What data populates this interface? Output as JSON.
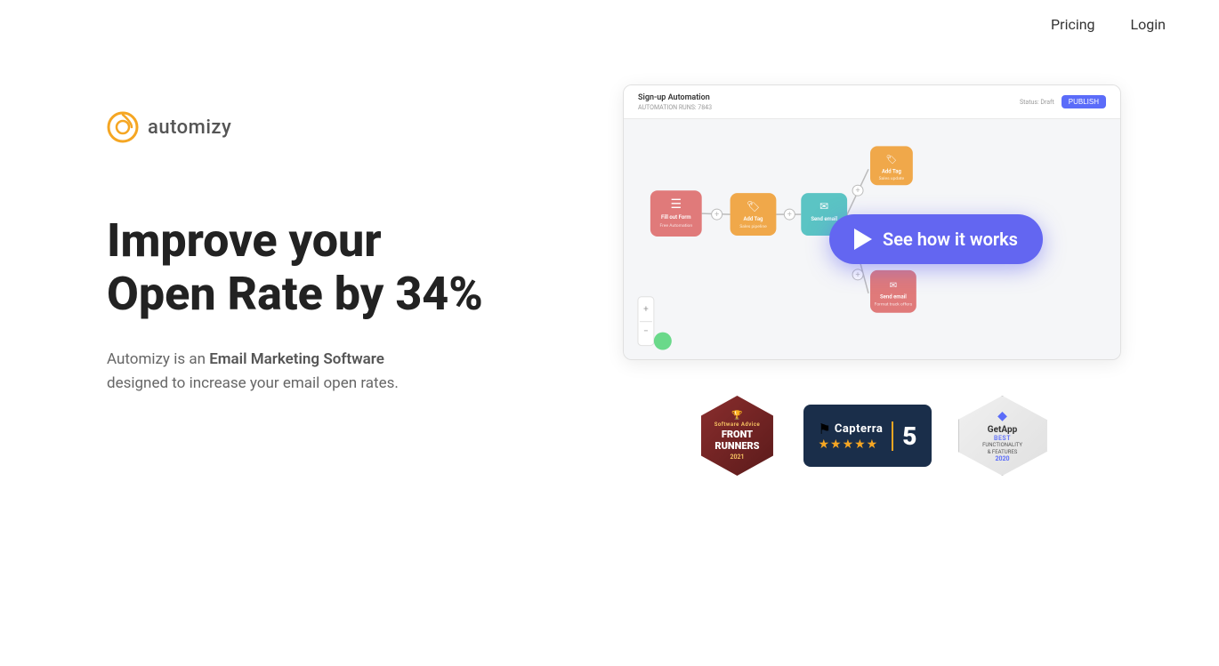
{
  "header": {
    "pricing_label": "Pricing",
    "login_label": "Login"
  },
  "logo": {
    "text": "automizy"
  },
  "hero": {
    "headline_line1": "Improve your",
    "headline_line2": "Open Rate by 34%",
    "subtext_prefix": "Automizy is an ",
    "subtext_bold": "Email Marketing Software",
    "subtext_suffix": " designed to increase your email open rates."
  },
  "screenshot": {
    "topbar_title": "Sign-up Automation",
    "topbar_sub": "AUTOMATION RUNS: 7843",
    "topbar_status": "Status: Draft",
    "topbar_button": "PUBLISH"
  },
  "play_button": {
    "label": "See how it works"
  },
  "badges": {
    "software_advice": {
      "top_label": "Software",
      "sub_label": "Advice",
      "badge_type": "FRONT\nRUNNERS",
      "year": "2021"
    },
    "capterra": {
      "name": "Capterra",
      "stars": "★★★★★",
      "number": "5"
    },
    "getapp": {
      "name": "GetApp",
      "badge_label": "BEST",
      "sub_label": "FUNCTIONALITY\n& FEATURES",
      "year": "2020"
    }
  }
}
